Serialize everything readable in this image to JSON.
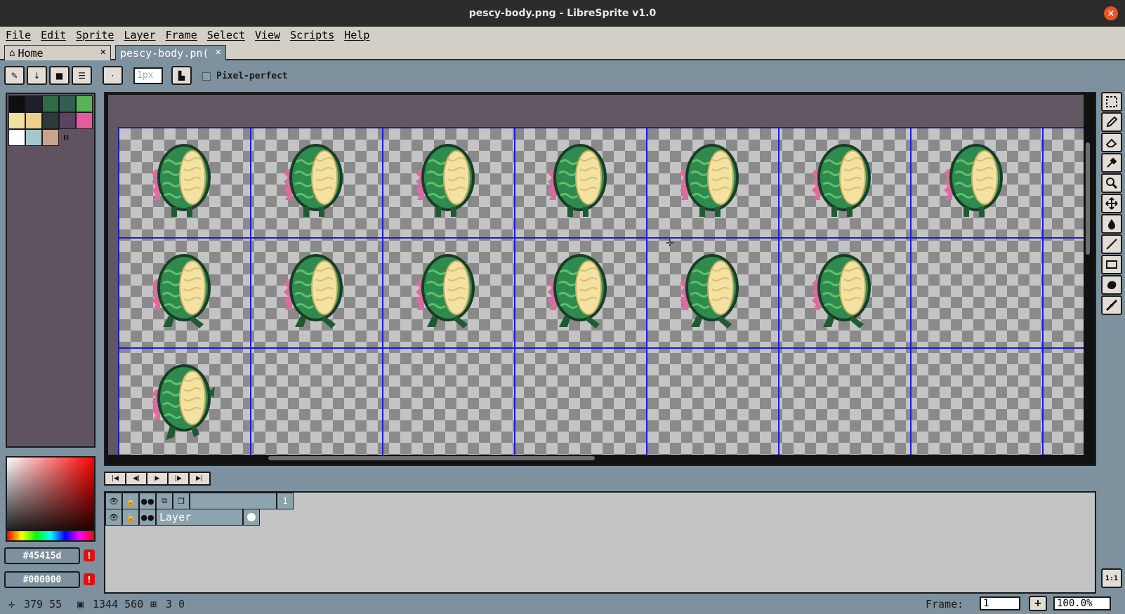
{
  "window": {
    "title": "pescy-body.png - LibreSprite v1.0",
    "close_label": "×"
  },
  "menu": [
    "File",
    "Edit",
    "Sprite",
    "Layer",
    "Frame",
    "Select",
    "View",
    "Scripts",
    "Help"
  ],
  "tabs": [
    {
      "label": "Home",
      "close": "✕"
    },
    {
      "label": "pescy-body.pn(",
      "close": "✕"
    }
  ],
  "context_bar": {
    "brush_size_placeholder": "1px",
    "pixel_perfect_label": "Pixel-perfect"
  },
  "palette": {
    "colors": [
      "#0e0e0e",
      "#1f2029",
      "#2f6b45",
      "#335e54",
      "#58b356",
      "#f3dfa0",
      "#ead08a",
      "#2d3a3a",
      "#5a4460",
      "#e55a9b",
      "#ffffff",
      "#a7c7cf",
      "#c9a38a"
    ],
    "marker": "II"
  },
  "colors": {
    "foreground": "#45415d",
    "background": "#000000",
    "warning": "!"
  },
  "timeline": {
    "frame_number": "1",
    "layer_name": "Layer"
  },
  "status": {
    "cursor": "379 55",
    "size": "1344 560",
    "grid": "3 0",
    "frame_label": "Frame:",
    "frame_value": "1",
    "add_label": "+",
    "zoom_value": "100.0%"
  },
  "zoom_button": "1:1",
  "sprite_grid": {
    "row1": 7,
    "row2": 6,
    "row3": 1
  }
}
